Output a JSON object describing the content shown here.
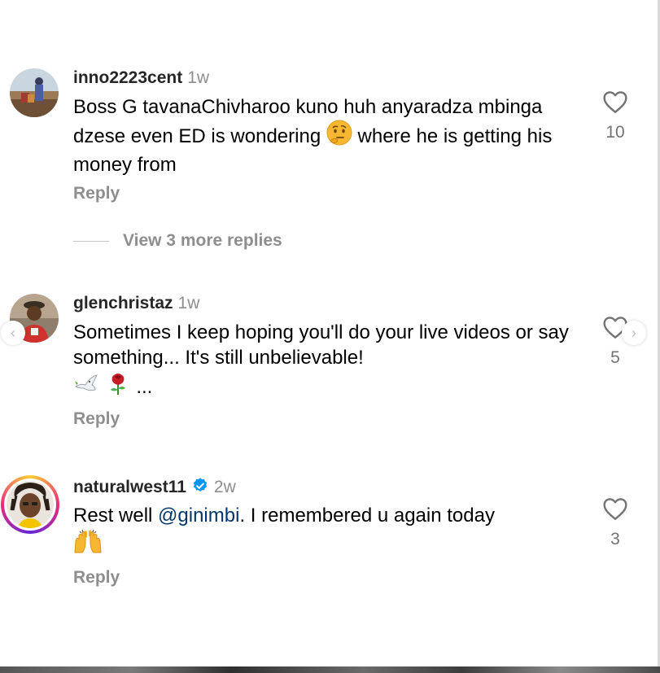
{
  "comments": [
    {
      "username": "inno2223cent",
      "time": "1w",
      "text": "Boss G tavanaChivharoo kuno huh anyaradza mbinga dzese even ED is wondering",
      "text_after_emoji": " where he is getting his money from",
      "emoji_icon": "thinking-face-emoji",
      "reply_label": "Reply",
      "likes": "10",
      "view_replies_label": "View 3 more replies"
    },
    {
      "username": "glenchristaz",
      "time": "1w",
      "text": "Sometimes I keep hoping you'll do your live videos or say something... It's still unbelievable!",
      "trailing_text": "...",
      "emoji_icons": [
        "dove-emoji",
        "rose-emoji"
      ],
      "reply_label": "Reply",
      "likes": "5"
    },
    {
      "username": "naturalwest11",
      "verified": true,
      "time": "2w",
      "text_before_mention": "Rest well ",
      "mention": "@ginimbi",
      "text_after_mention": ". I remembered u again today",
      "emoji_icon": "raising-hands-emoji",
      "reply_label": "Reply",
      "likes": "3"
    }
  ],
  "icons": {
    "like": "heart-outline-icon",
    "carousel_prev": "chevron-left-icon",
    "carousel_next": "chevron-right-icon",
    "verified": "verified-badge-icon"
  },
  "colors": {
    "mention": "#00376b",
    "secondary_text": "#8e8e8e",
    "verified_badge": "#0095f6"
  }
}
